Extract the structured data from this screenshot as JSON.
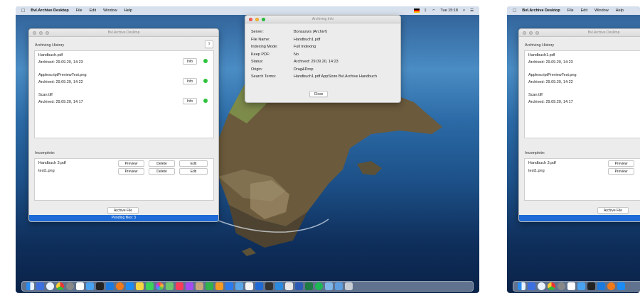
{
  "menubar": {
    "app_name": "Bvl.Archive Desktop",
    "menus": [
      "File",
      "Edit",
      "Window",
      "Help"
    ],
    "clock": "Tue 15:18",
    "battery": "⚡",
    "search": "⌕",
    "control": "☰",
    "bluetooth": "ᛒ",
    "wifi": "⌔"
  },
  "main_window": {
    "title": "Bvl.Archive Desktop",
    "history_label": "Archiving History",
    "help": "?",
    "history": [
      {
        "name": "Handbuch.pdf",
        "date": "Archived: 29.09.20, 14:23",
        "info": "Info"
      },
      {
        "name": "ApplescriptPreviewTest.png",
        "date": "Archived: 29.09.20, 14:22",
        "info": "Info"
      },
      {
        "name": "Scan.tiff",
        "date": "Archived: 29.09.20, 14:17",
        "info": "Info"
      }
    ],
    "incomplete_label": "Incomplete:",
    "incomplete": [
      {
        "name": "Handbuch 3.pdf",
        "preview": "Preview",
        "delete": "Delete",
        "edit": "Edit"
      },
      {
        "name": "test1.png",
        "preview": "Preview",
        "delete": "Delete",
        "edit": "Edit"
      }
    ],
    "archive_button": "Archive File",
    "status": "Pending files: 3"
  },
  "info_window": {
    "title": "Archiving Info",
    "rows": [
      {
        "key": "Server:",
        "value": "Bonsaxvis (Archiv!)"
      },
      {
        "key": "File Name:",
        "value": "Handbuch1.pdf"
      },
      {
        "key": "Indexing Mode:",
        "value": "Full Indexing"
      },
      {
        "key": "Keep PDF:",
        "value": "No"
      },
      {
        "key": "Status:",
        "value": "Archived: 29.09.20, 14:23"
      },
      {
        "key": "Origin:",
        "value": "Drag&Drop"
      },
      {
        "key": "Search Terms:",
        "value": "Handbuch1.pdf AppStore Bvl.Archive Handbuch"
      }
    ],
    "close": "Close"
  },
  "right_screen": {
    "app_name": "Bvl.Archive Desktop",
    "menus": [
      "File",
      "Edit",
      "Window",
      "Help"
    ],
    "window_title": "Bvl.Archive Desktop",
    "history_label": "Archiving History",
    "history": [
      {
        "name": "Handbuch1.pdf",
        "date": "Archived: 29.09.20, 14:23"
      },
      {
        "name": "ApplescriptPreviewTest.png",
        "date": "Archived: 29.09.20, 14:22"
      },
      {
        "name": "Scan.tiff",
        "date": "Archived: 29.09.20, 14:17"
      }
    ],
    "incomplete_label": "Incomplete:",
    "incomplete": [
      {
        "name": "Handbuch 3.pdf",
        "preview": "Preview"
      },
      {
        "name": "test1.png",
        "preview": "Preview"
      }
    ],
    "archive_button": "Archive File"
  },
  "colors": {
    "status_bar": "#1e6ad6",
    "indicator": "#2fc23c"
  }
}
